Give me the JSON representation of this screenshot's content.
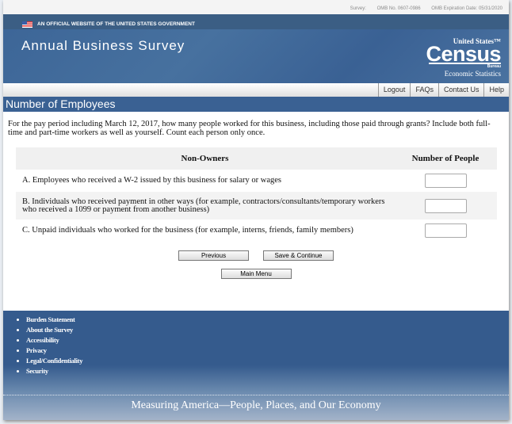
{
  "topbar": {
    "survey": "Survey:",
    "omb": "OMB No. 0607-0986",
    "expiration": "OMB Expiration Date: 05/31/2020"
  },
  "header": {
    "gov_banner": "AN OFFICIAL WEBSITE OF THE UNITED STATES GOVERNMENT",
    "title": "Annual Business Survey",
    "logo": {
      "line1": "United States™",
      "line2": "Census",
      "line3": "Bureau",
      "line4": "Economic Statistics"
    }
  },
  "nav": [
    "Logout",
    "FAQs",
    "Contact Us",
    "Help"
  ],
  "section_title": "Number of Employees",
  "question": "For the pay period including March 12, 2017, how many people worked for this business, including those paid through grants? Include both full-time and part-time workers as well as yourself. Count each person only once.",
  "table": {
    "headers": [
      "Non-Owners",
      "Number of People"
    ],
    "rows": [
      {
        "label": "A. Employees who received a W-2 issued by this business for salary or wages",
        "value": ""
      },
      {
        "label": "B. Individuals who received payment in other ways (for example, contractors/consultants/temporary workers who received a 1099 or payment from another business)",
        "value": ""
      },
      {
        "label": "C. Unpaid individuals who worked for the business (for example, interns, friends, family members)",
        "value": ""
      }
    ]
  },
  "buttons": {
    "previous": "Previous",
    "save": "Save & Continue",
    "main_menu": "Main Menu"
  },
  "footer": {
    "links": [
      "Burden Statement",
      "About the Survey",
      "Accessibility",
      "Privacy",
      "Legal/Confidentiality",
      "Security"
    ],
    "tagline": "Measuring America—People, Places, and Our Economy"
  }
}
